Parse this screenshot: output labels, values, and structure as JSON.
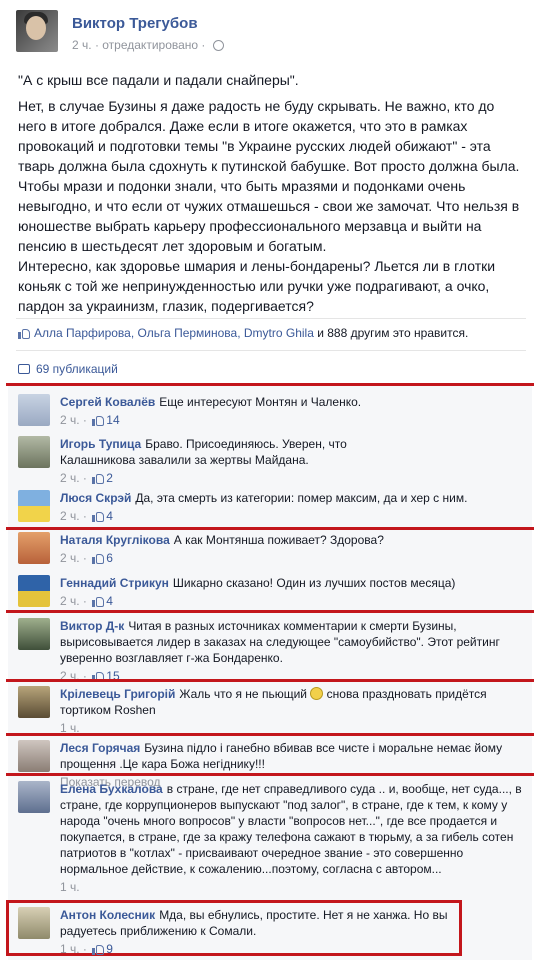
{
  "post": {
    "author": "Виктор Трегубов",
    "time": "2 ч.",
    "edited": "· отредактировано ·",
    "paragraphs": [
      "\"А с крыш все падали и падали снайперы\".",
      "Нет, в случае Бузины я даже радость не буду скрывать. Не важно, кто до него в итоге добрался. Даже если в итоге окажется, что это в рамках провокаций и подготовки темы \"в Украине русских людей обижают\" - эта тварь должна была сдохнуть к путинской бабушке. Вот просто должна была. Чтобы мрази и подонки знали, что быть мразями и подонками очень невыгодно, и что если от чужих отмашешься - свои же замочат. Что нельзя в юношестве выбрать карьеру профессионального мерзавца и выйти на пенсию в шестьдесят лет здоровым и богатым.",
      "Интересно, как здоровье шмария и лены-бондарены? Льется ли в глотки коньяк с той же непринужденностью или ручки уже подрагивают, а очко, пардон за украинизм, глазик, подергивается?"
    ],
    "likes_names": "Алла Парфирова, Ольга Перминова, Dmytro Ghila",
    "likes_rest": " и 888 другим это нравится.",
    "shares": "69 публикаций"
  },
  "comments": [
    {
      "name": "Сергей Ковалёв",
      "text": "Еще интересуют Монтян и Чаленко.",
      "time": "2 ч. ·",
      "likes": "14"
    },
    {
      "name": "Игорь Тупица",
      "text": "Браво. Присоединяюсь. Уверен, что Калашникова завалили за жертвы Майдана.",
      "time": "2 ч. ·",
      "likes": "2"
    },
    {
      "name": "Люся Скрэй",
      "text": "Да, эта смерть из категории: помер максим, да и хер с ним.",
      "time": "2 ч. ·",
      "likes": "4"
    },
    {
      "name": "Наталя Круглікова",
      "text": "А как Монтянша поживает? Здорова?",
      "time": "2 ч. ·",
      "likes": "6"
    },
    {
      "name": "Геннадий Стрикун",
      "text": "Шикарно сказано! Один из лучших постов месяца)",
      "time": "2 ч. ·",
      "likes": "4"
    },
    {
      "name": "Виктор Д-к",
      "text": "Читая в разных источниках комментарии к смерти Бузины, вырисовывается лидер в заказах на следующее \"самоубийство\". Этот рейтинг уверенно возглавляет г-жа Бондаренко.",
      "time": "2 ч. ·",
      "likes": "15"
    },
    {
      "name": "Крілевець Григорій",
      "text": "Жаль что я не пьющий",
      "text2": "снова праздновать придётся тортиком Roshen",
      "time": "1 ч."
    },
    {
      "name": "Леся Горячая",
      "text": "Бузина підло і ганебно вбивав все чисте і моральне немає йому прощення .Це кара Божа негіднику!!!",
      "time": "Показать перевод"
    },
    {
      "name": "Елена Бухкалова",
      "text": "в стране, где нет справедливого суда .. и, вообще, нет суда..., в стране, где коррупционеров выпускают \"под залог\", в стране, где к тем, к кому у народа \"очень много вопросов\" у власти \"вопросов нет...\", где все продается и покупается, в стране, где за кражу телефона сажают в тюрьму, а за гибель сотен патриотов в \"котлах\" - присваивают очередное звание - это совершенно нормальное действие, к сожалению...поэтому, согласна с автором...",
      "time": "1 ч."
    },
    {
      "name": "Антон Колесник",
      "text": "Мда, вы ебнулись, простите. Нет я не ханжа. Но вы радуетесь приближению к Сомали.",
      "time": "1 ч. ·",
      "likes": "9"
    }
  ]
}
